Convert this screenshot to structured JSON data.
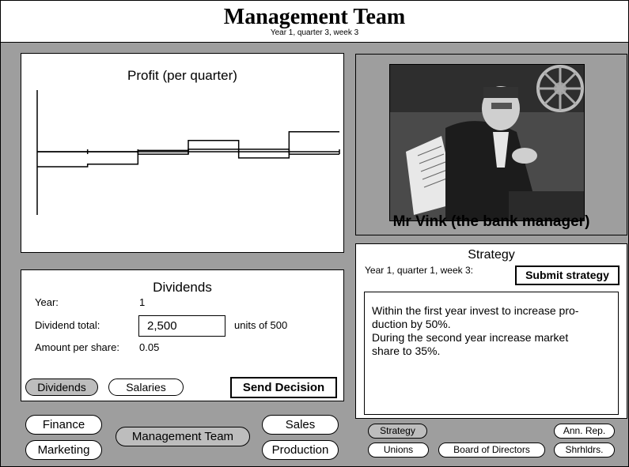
{
  "header": {
    "title": "Management Team",
    "subtitle": "Year 1, quarter 3, week 3"
  },
  "profit": {
    "chart_data": {
      "type": "line",
      "title": "Profit (per quarter)",
      "x": [
        1,
        2,
        3,
        4,
        5,
        6
      ],
      "series": [
        {
          "values": [
            -1.2,
            -1.0,
            0.1,
            0.9,
            -0.5,
            1.6
          ]
        },
        {
          "values": [
            0.0,
            0.0,
            -0.2,
            0.2,
            0.2,
            -0.2
          ]
        }
      ],
      "ylim": [
        -5,
        5
      ],
      "grid": false
    }
  },
  "manager": {
    "name": "Mr Vink (the bank manager)",
    "photo_icon": "bank-manager-photo"
  },
  "dividends": {
    "title": "Dividends",
    "year_label": "Year:",
    "year_value": "1",
    "total_label": "Dividend total:",
    "total_value": "2,500",
    "total_unit": "units of 500",
    "per_share_label": "Amount per share:",
    "per_share_value": "0.05",
    "tab_dividends": "Dividends",
    "tab_salaries": "Salaries",
    "send_label": "Send Decision"
  },
  "strategy": {
    "title": "Strategy",
    "date": "Year 1, quarter 1, week 3:",
    "submit_label": "Submit strategy",
    "text": "Within the first year invest to increase pro-\nduction by 50%.\nDuring the second year increase market\nshare to 35%.",
    "tabs": {
      "strategy": "Strategy",
      "annrep": "Ann. Rep.",
      "unions": "Unions",
      "board": "Board of Directors",
      "shrhldrs": "Shrhldrs."
    }
  },
  "nav": {
    "finance": "Finance",
    "marketing": "Marketing",
    "management": "Management Team",
    "sales": "Sales",
    "production": "Production"
  }
}
